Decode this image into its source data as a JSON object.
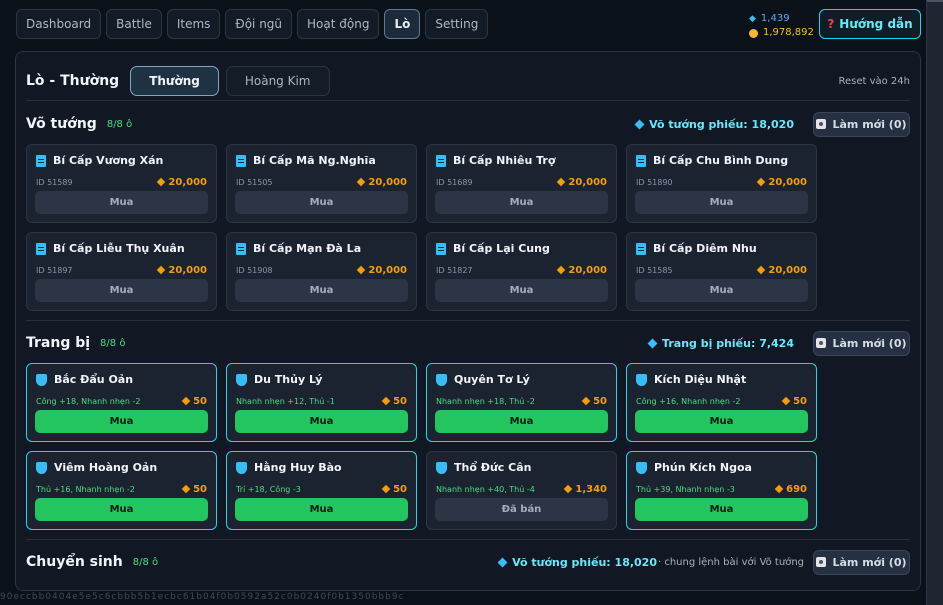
{
  "nav": [
    "Dashboard",
    "Battle",
    "Items",
    "Đội ngũ",
    "Hoạt động",
    "Lò",
    "Setting"
  ],
  "currency": {
    "gems": "1,439",
    "gold": "1,978,892"
  },
  "help_label": "Hướng dẫn",
  "forge": {
    "title": "Lò - Thường",
    "tabs": [
      "Thường",
      "Hoàng Kim"
    ],
    "reset": "Reset vào 24h"
  },
  "heroes": {
    "title": "Võ tướng",
    "count": "8/8 ô",
    "voucher": "Võ tướng phiếu: 18,020",
    "refresh": "Làm mới (0)",
    "cards": [
      {
        "name": "Bí Cấp Vương Xán",
        "id": "ID 51589",
        "price": "20,000",
        "action": "Mua"
      },
      {
        "name": "Bí Cấp Mã Ng.Nghĩa",
        "id": "ID 51505",
        "price": "20,000",
        "action": "Mua"
      },
      {
        "name": "Bí Cấp Nhiêu Trợ",
        "id": "ID 51689",
        "price": "20,000",
        "action": "Mua"
      },
      {
        "name": "Bí Cấp Chu Bình Dung",
        "id": "ID 51890",
        "price": "20,000",
        "action": "Mua"
      },
      {
        "name": "Bí Cấp Liễu Thụ Xuân",
        "id": "ID 51897",
        "price": "20,000",
        "action": "Mua"
      },
      {
        "name": "Bí Cấp Mạn Đà La",
        "id": "ID 51908",
        "price": "20,000",
        "action": "Mua"
      },
      {
        "name": "Bí Cấp Lại Cung",
        "id": "ID 51827",
        "price": "20,000",
        "action": "Mua"
      },
      {
        "name": "Bí Cấp Diêm Nhu",
        "id": "ID 51585",
        "price": "20,000",
        "action": "Mua"
      }
    ]
  },
  "gear": {
    "title": "Trang bị",
    "count": "8/8 ô",
    "voucher": "Trang bị phiếu: 7,424",
    "refresh": "Làm mới (0)",
    "cards": [
      {
        "name": "Bắc Đẩu Oản",
        "stats": "Công +18, Nhanh nhẹn -2",
        "price": "50",
        "action": "Mua",
        "state": "buy"
      },
      {
        "name": "Du Thủy Lý",
        "stats": "Nhanh nhẹn +12, Thủ -1",
        "price": "50",
        "action": "Mua",
        "state": "buy"
      },
      {
        "name": "Quyên Tơ Lý",
        "stats": "Nhanh nhẹn +18, Thủ -2",
        "price": "50",
        "action": "Mua",
        "state": "buy"
      },
      {
        "name": "Kích Diệu Nhật",
        "stats": "Công +16, Nhanh nhẹn -2",
        "price": "50",
        "action": "Mua",
        "state": "buy"
      },
      {
        "name": "Viêm Hoàng Oản",
        "stats": "Thủ +16, Nhanh nhẹn -2",
        "price": "50",
        "action": "Mua",
        "state": "buy"
      },
      {
        "name": "Hằng Huy Bào",
        "stats": "Trí +18, Công -3",
        "price": "50",
        "action": "Mua",
        "state": "buy"
      },
      {
        "name": "Thổ Đức Cân",
        "stats": "Nhanh nhẹn +40, Thủ -4",
        "price": "1,340",
        "action": "Đã bán",
        "state": "sold"
      },
      {
        "name": "Phún Kích Ngoa",
        "stats": "Thủ +39, Nhanh nhẹn -3",
        "price": "690",
        "action": "Mua",
        "state": "buy"
      }
    ]
  },
  "rebirth": {
    "title": "Chuyển sinh",
    "count": "8/8 ô",
    "voucher": "Võ tướng phiếu: 18,020",
    "hint": "· chung lệnh bài với Võ tướng",
    "refresh": "Làm mới (0)"
  },
  "stray_text": "90eccbb0404e5e5c6cbbb5b1ecbc61b04f0b0592a52c0b0240f0b1350bbb9c"
}
